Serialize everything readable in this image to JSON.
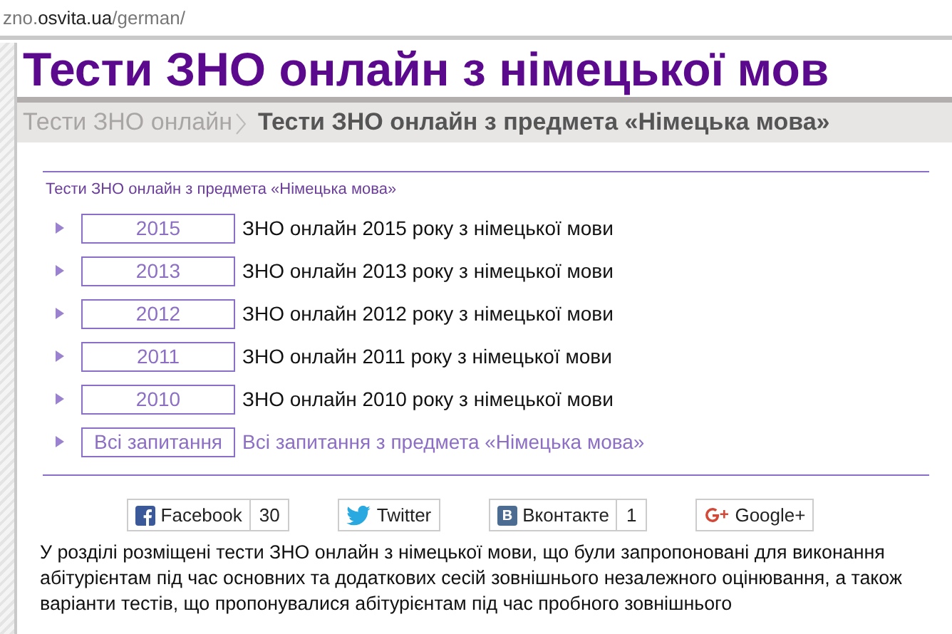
{
  "address_bar": {
    "url_parts": [
      {
        "text": "zno.",
        "strong": false
      },
      {
        "text": "osvita.ua",
        "strong": true
      },
      {
        "text": "/german/",
        "strong": false
      }
    ]
  },
  "page_title": "Тести ЗНО онлайн з німецької мов",
  "breadcrumbs": [
    {
      "label": "Тести ЗНО онлайн",
      "current": false
    },
    {
      "label": "Тести ЗНО онлайн з предмета «Німецька мова»",
      "current": true
    }
  ],
  "section": {
    "heading": "Тести ЗНО онлайн з предмета «Німецька мова»",
    "items": [
      {
        "badge": "2015",
        "label": "ЗНО онлайн 2015 року з німецької мови",
        "kind": "year"
      },
      {
        "badge": "2013",
        "label": "ЗНО онлайн 2013 року з німецької мови",
        "kind": "year"
      },
      {
        "badge": "2012",
        "label": "ЗНО онлайн 2012 року з німецької мови",
        "kind": "year"
      },
      {
        "badge": "2011",
        "label": "ЗНО онлайн 2011 року з німецької мови",
        "kind": "year"
      },
      {
        "badge": "2010",
        "label": "ЗНО онлайн 2010 року з німецької мови",
        "kind": "year"
      },
      {
        "badge": "Всі запитання",
        "label": "Всі запитання з предмета «Німецька мова»",
        "kind": "all"
      }
    ]
  },
  "share_buttons": [
    {
      "kind": "facebook",
      "label": "Facebook",
      "count": "30"
    },
    {
      "kind": "twitter",
      "label": "Twitter"
    },
    {
      "kind": "vk",
      "label": "Вконтакте",
      "count": "1"
    },
    {
      "kind": "google",
      "label": "Google+"
    }
  ],
  "description": "У розділі розміщені тести ЗНО онлайн з німецької мови, що були запропоновані для виконання абітурієнтам під час основних та додаткових сесій зовнішнього незалежного оцінювання, а також варіанти тестів, що пропонувалися абітурієнтам під час пробного зовнішнього"
}
